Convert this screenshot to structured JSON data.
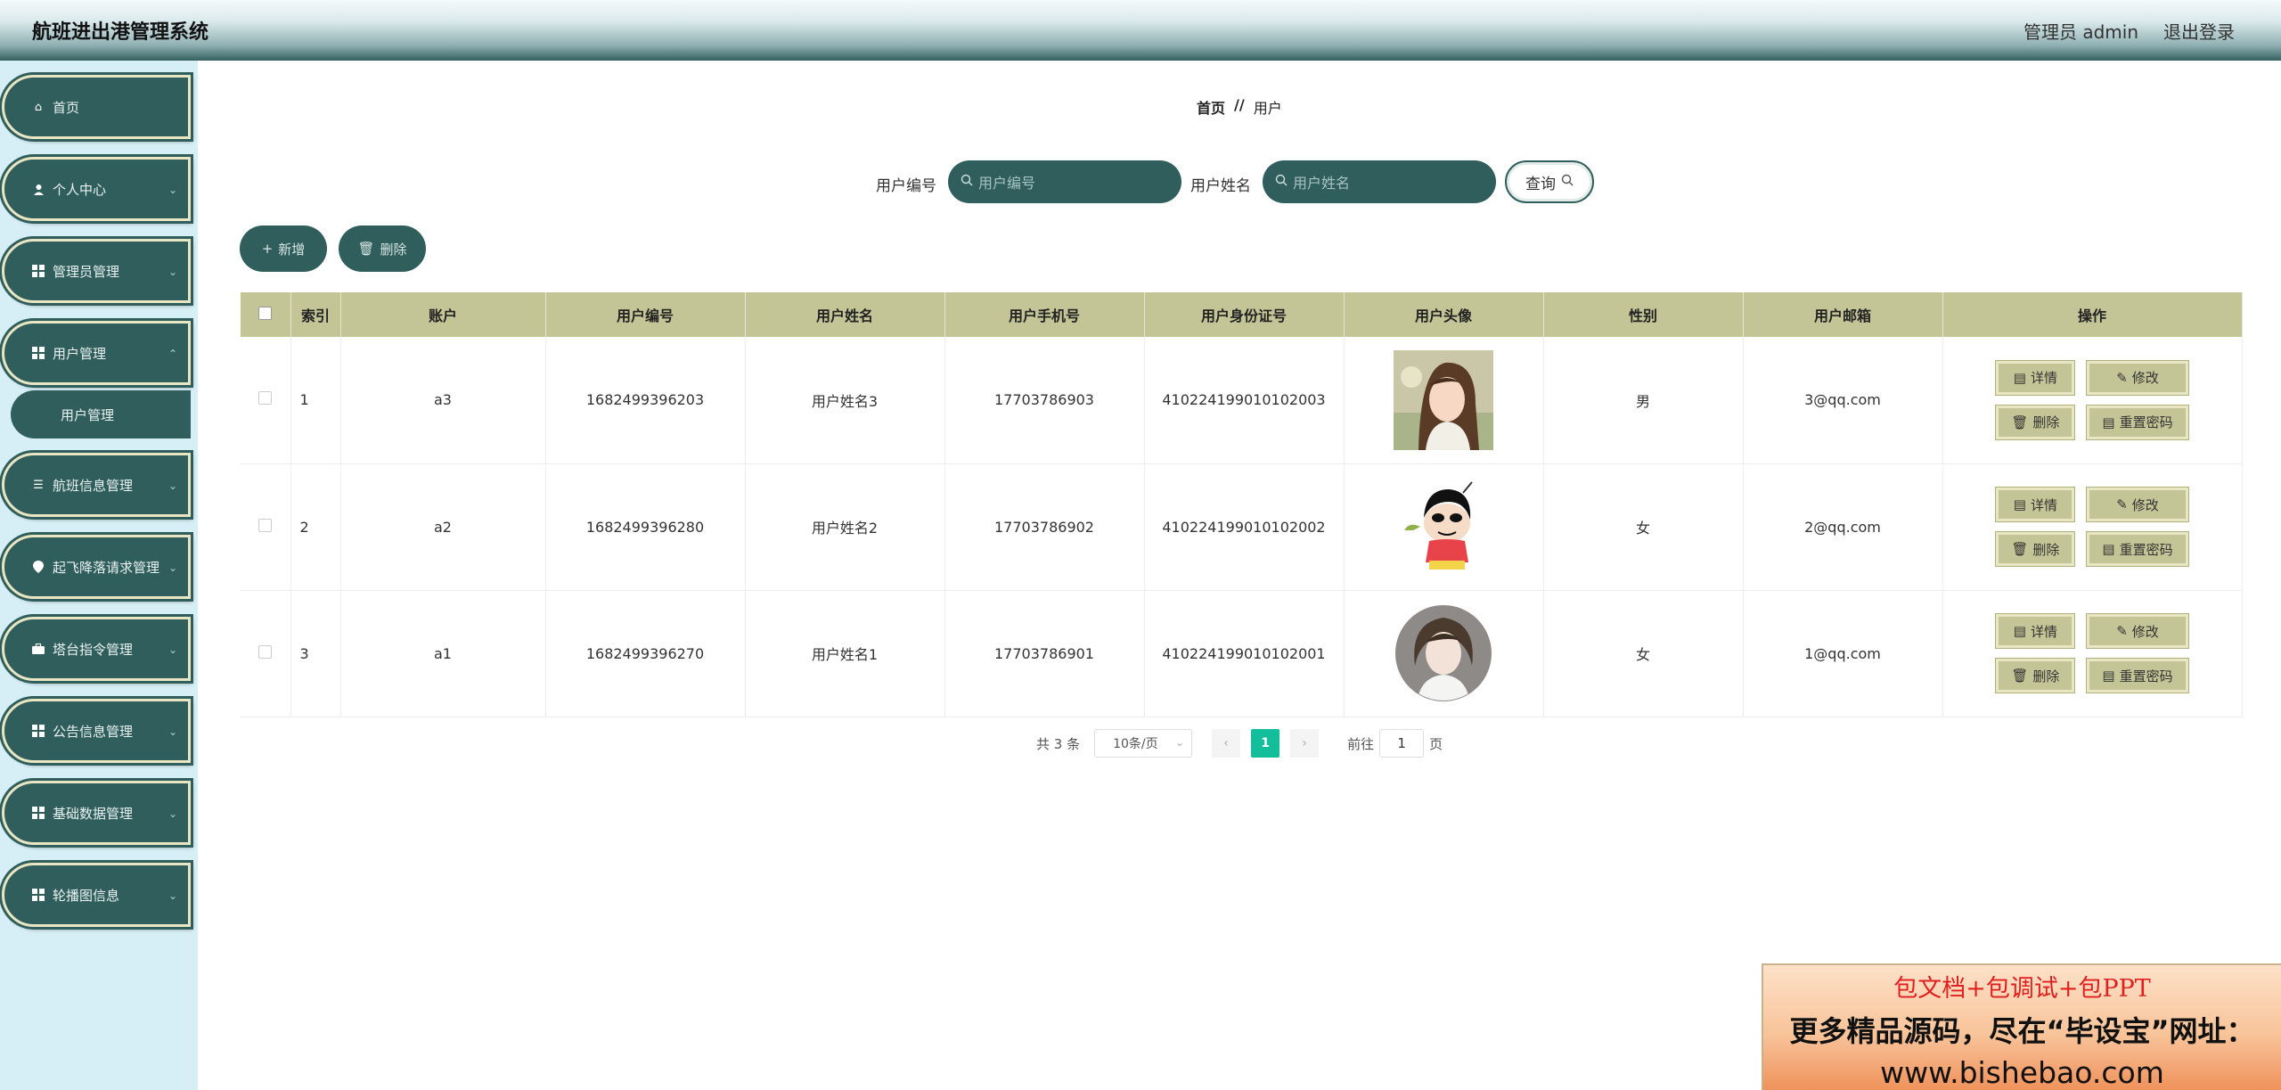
{
  "app": {
    "title": "航班进出港管理系统"
  },
  "header": {
    "user": "管理员 admin",
    "logout": "退出登录"
  },
  "sidebar": {
    "items": [
      {
        "label": "首页",
        "icon": "home-icon"
      },
      {
        "label": "个人中心",
        "icon": "user-icon"
      },
      {
        "label": "管理员管理",
        "icon": "grid-icon"
      },
      {
        "label": "用户管理",
        "icon": "grid-icon"
      },
      {
        "label": "航班信息管理",
        "icon": "list-icon"
      },
      {
        "label": "起飞降落请求管理",
        "icon": "location-icon"
      },
      {
        "label": "塔台指令管理",
        "icon": "briefcase-icon"
      },
      {
        "label": "公告信息管理",
        "icon": "grid-icon"
      },
      {
        "label": "基础数据管理",
        "icon": "grid-icon"
      },
      {
        "label": "轮播图信息",
        "icon": "grid-icon"
      }
    ],
    "sub": {
      "label": "用户管理"
    }
  },
  "breadcrumb": {
    "home": "首页",
    "sep": "//",
    "current": "用户"
  },
  "search": {
    "label1": "用户编号",
    "placeholder1": "用户编号",
    "label2": "用户姓名",
    "placeholder2": "用户姓名",
    "query": "查询"
  },
  "actions": {
    "add": "新增",
    "delete": "删除"
  },
  "table": {
    "headers": [
      "索引",
      "账户",
      "用户编号",
      "用户姓名",
      "用户手机号",
      "用户身份证号",
      "用户头像",
      "性别",
      "用户邮箱",
      "操作"
    ],
    "rows": [
      {
        "index": "1",
        "account": "a3",
        "code": "1682499396203",
        "name": "用户姓名3",
        "phone": "17703786903",
        "idcard": "410224199010102003",
        "gender": "男",
        "email": "3@qq.com"
      },
      {
        "index": "2",
        "account": "a2",
        "code": "1682499396280",
        "name": "用户姓名2",
        "phone": "17703786902",
        "idcard": "410224199010102002",
        "gender": "女",
        "email": "2@qq.com"
      },
      {
        "index": "3",
        "account": "a1",
        "code": "1682499396270",
        "name": "用户姓名1",
        "phone": "17703786901",
        "idcard": "410224199010102001",
        "gender": "女",
        "email": "1@qq.com"
      }
    ],
    "ops": {
      "detail": "详情",
      "edit": "修改",
      "delete": "删除",
      "reset": "重置密码"
    }
  },
  "pagination": {
    "total": "共 3 条",
    "page_size": "10条/页",
    "current": "1",
    "goto_prefix": "前往",
    "goto_value": "1",
    "goto_suffix": "页"
  },
  "ad": {
    "line1": "包文档+包调试+包PPT",
    "line2": "更多精品源码，尽在“毕设宝”网址：",
    "line3": "www.bishebao.com"
  },
  "colors": {
    "primary": "#2f5e5c",
    "table_header": "#c4c596",
    "page_active": "#13bf9a",
    "sidebar_bg": "#d6eef5"
  }
}
